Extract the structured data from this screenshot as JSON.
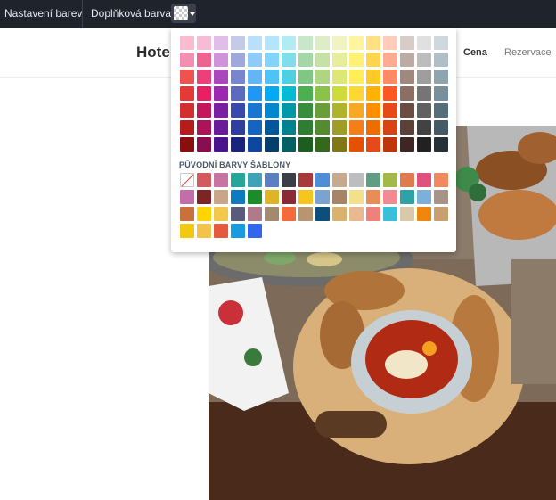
{
  "topbar": {
    "color_settings_label": "Nastavení barev",
    "accent_color_label": "Doplňková barva"
  },
  "site": {
    "brand": "Hote",
    "nav": [
      "Cena",
      "Rezervace"
    ]
  },
  "palette": {
    "rows": [
      [
        "#f8bbd0",
        "#f6bcd5",
        "#e1bee7",
        "#c5cae9",
        "#bbdefb",
        "#b3e5fc",
        "#b2ebf2",
        "#c8e6c9",
        "#dcedc8",
        "#f0f4c3",
        "#fff59d",
        "#ffe082",
        "#ffccbc",
        "#d7ccc8",
        "#e0e0e0",
        "#cfd8dc"
      ],
      [
        "#f48fb1",
        "#f06292",
        "#ce93d8",
        "#9fa8da",
        "#90caf9",
        "#81d4fa",
        "#80deea",
        "#a5d6a7",
        "#c5e1a5",
        "#e6ee9c",
        "#fff176",
        "#ffd54f",
        "#ffab91",
        "#bcaaa4",
        "#bdbdbd",
        "#b0bec5"
      ],
      [
        "#ef5350",
        "#ec407a",
        "#ab47bc",
        "#7986cb",
        "#64b5f6",
        "#4fc3f7",
        "#4dd0e1",
        "#81c784",
        "#aed581",
        "#dce775",
        "#ffee58",
        "#ffca28",
        "#ff8a65",
        "#a1887f",
        "#9e9e9e",
        "#90a4ae"
      ],
      [
        "#e53935",
        "#e91e63",
        "#9c27b0",
        "#5c6bc0",
        "#2196f3",
        "#03a9f4",
        "#00bcd4",
        "#4caf50",
        "#8bc34a",
        "#cddc39",
        "#fdd835",
        "#ffb300",
        "#ff5722",
        "#8d6e63",
        "#757575",
        "#78909c"
      ],
      [
        "#d32f2f",
        "#c2185b",
        "#7b1fa2",
        "#3949ab",
        "#1976d2",
        "#0288d1",
        "#0097a7",
        "#388e3c",
        "#689f38",
        "#afb42b",
        "#f9a825",
        "#ff8f00",
        "#e64a19",
        "#6d4c41",
        "#616161",
        "#546e7a"
      ],
      [
        "#b71c1c",
        "#ad1457",
        "#6a1b9a",
        "#303f9f",
        "#1565c0",
        "#01579b",
        "#00838f",
        "#2e7d32",
        "#558b2f",
        "#9e9d24",
        "#f57f17",
        "#ef6c00",
        "#d84315",
        "#5d4037",
        "#424242",
        "#455a64"
      ],
      [
        "#8b0e0e",
        "#880e4f",
        "#4a148c",
        "#1a237e",
        "#0d47a1",
        "#053d6e",
        "#006064",
        "#1b5e20",
        "#33691e",
        "#827717",
        "#e65100",
        "#e64a19",
        "#bf360c",
        "#3e2723",
        "#212121",
        "#263238"
      ]
    ],
    "template_title": "PŮVODNÍ BARVY ŠABLONY",
    "template_rows": [
      [
        "none",
        "#d35b5b",
        "#c773a3",
        "#26a69a",
        "#3fa3b8",
        "#5b7fc0",
        "#3a3f47",
        "#a83a3a",
        "#4c8fd6",
        "#c9a890",
        "#bdbdbd",
        "#5e9e85",
        "#a3b84a",
        "#e07a4f",
        "#e0527d",
        "#f08a5d"
      ],
      [
        "#c26ea8",
        "#7d2525",
        "#c9a58a",
        "#0f7bbf",
        "#1c8c2a",
        "#e0b429",
        "#8a2a36",
        "#f7c51c",
        "#7aa3d1",
        "#a88467",
        "#f2e08a",
        "#e88c5a",
        "#f28a94",
        "#2da3a8",
        "#7ab0d9",
        "#a99389"
      ],
      [
        "#c9703c",
        "#ffd500",
        "#f2c94c",
        "#5a5a7a",
        "#b07a8a",
        "#a38a6e",
        "#f56a3c",
        "#b89470",
        "#0b4f7a",
        "#d9b36c",
        "#e8b88e",
        "#f0807a",
        "#39c0d9",
        "#d9c9a8",
        "#f0860c",
        "#c8a070"
      ],
      [
        "#f2c811",
        "#f2c24a",
        "#e55a3c",
        "#1a9be0",
        "#3366ee"
      ]
    ]
  }
}
